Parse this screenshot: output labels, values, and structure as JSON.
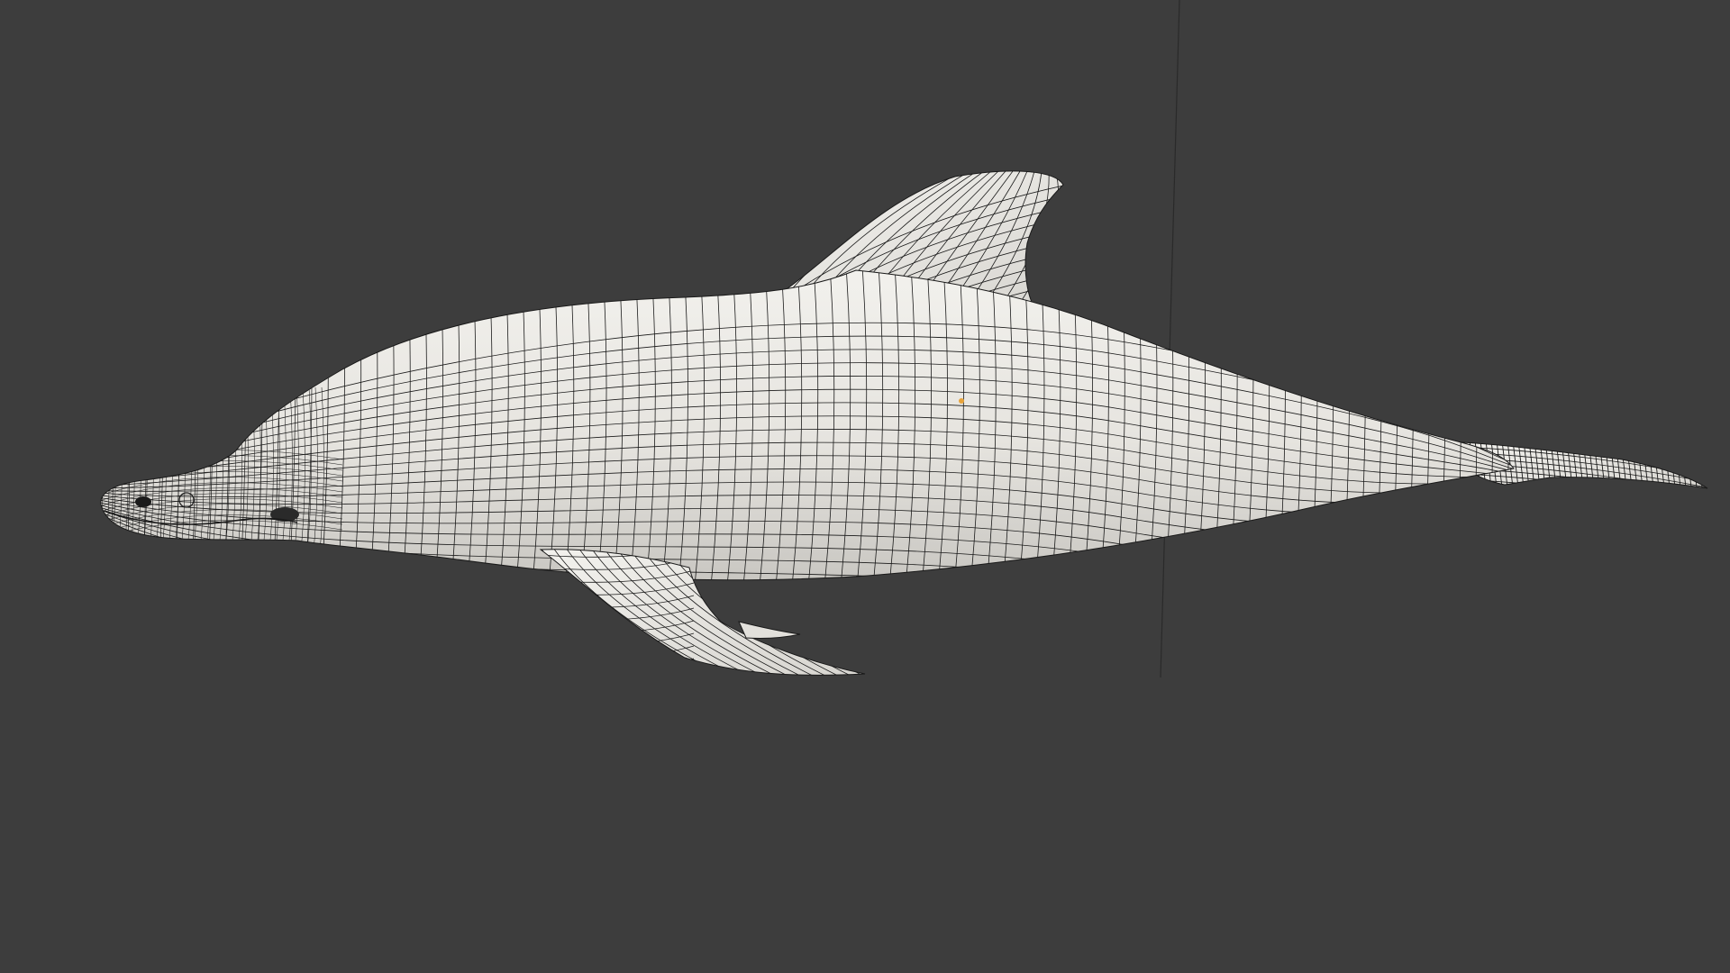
{
  "viewport": {
    "background_color": "#3d3d3d",
    "view": "3d-viewport-solid-wireframe"
  },
  "object": {
    "name_icon": "dolphin-mesh",
    "surface_color": "#e8e6e1",
    "wire_color": "#1a1a1a",
    "origin_color": "#e8a33a"
  },
  "axis_line": {
    "color": "#2a2a2a"
  }
}
